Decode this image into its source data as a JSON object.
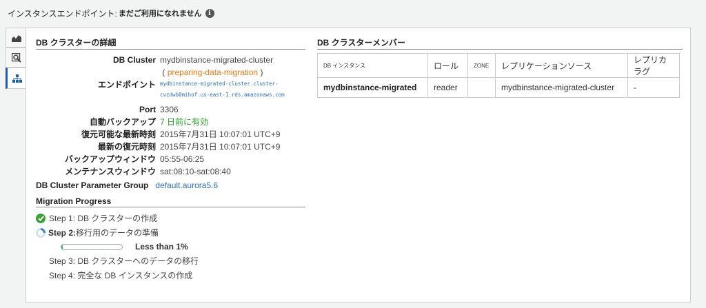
{
  "header": {
    "status_label": "インスタンスエンドポイント:",
    "status_value": "まだご利用になれません",
    "info_icon_text": "i"
  },
  "side_tabs": [
    {
      "icon": "chart-icon"
    },
    {
      "icon": "search-icon"
    },
    {
      "icon": "hierarchy-icon"
    }
  ],
  "details": {
    "title": "DB クラスターの詳細",
    "cluster_label": "DB Cluster",
    "cluster_value": "mydbinstance-migrated-cluster",
    "cluster_status_open": "(",
    "cluster_status": "preparing-data-migration",
    "cluster_status_close": ")",
    "endpoint_label": "エンドポイント",
    "endpoint_line1": "mydbinstance-migrated-cluster.cluster-",
    "endpoint_line2": "cvzdwb0mihof.us-east-1.rds.amazonaws.com",
    "port_label": "Port",
    "port_value": "3306",
    "backup_label": "自動バックアップ",
    "backup_value": "7 日前に有効",
    "restorable_label": "復元可能な最新時刻",
    "restorable_value": "2015年7月31日 10:07:01 UTC+9",
    "latest_restore_label": "最新の復元時刻",
    "latest_restore_value": "2015年7月31日 10:07:01 UTC+9",
    "backup_window_label": "バックアップウィンドウ",
    "backup_window_value": "05:55-06:25",
    "maintenance_label": "メンテナンスウィンドウ",
    "maintenance_value": "sat:08:10-sat:08:40",
    "param_group_label": "DB Cluster Parameter Group",
    "param_group_value": "default.aurora5.6"
  },
  "migration": {
    "title": "Migration Progress",
    "step1": "Step 1:  DB クラスターの作成",
    "step2_prefix": "Step 2:",
    "step2_text": " 移行用のデータの準備",
    "progress_fraction": 0.01,
    "progress_label": "Less than 1%",
    "step3": "Step 3:  DB クラスターへのデータの移行",
    "step4": "Step 4:  完全な DB インスタンスの作成"
  },
  "members": {
    "title": "DB クラスターメンバー",
    "columns": [
      "DB インスタンス",
      "ロール",
      "ZONE",
      "レプリケーションソース",
      "レプリカラグ"
    ],
    "rows": [
      [
        "mydbinstance-migrated",
        "reader",
        "",
        "mydbinstance-migrated-cluster",
        "-"
      ]
    ]
  }
}
